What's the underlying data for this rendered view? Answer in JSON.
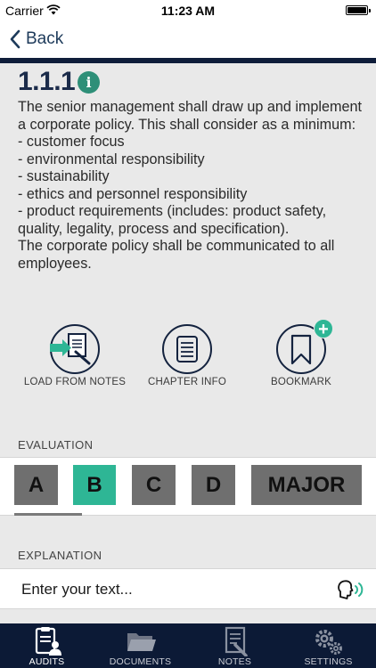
{
  "status_bar": {
    "carrier": "Carrier",
    "time": "11:23 AM"
  },
  "nav": {
    "back_label": "Back"
  },
  "requirement": {
    "number": "1.1.1",
    "text": "The senior management shall draw up and implement a corporate policy. This shall consider as a minimum:\n- customer focus\n- environmental responsibility\n- sustainability\n- ethics and personnel responsibility\n- product requirements (includes: product safety, quality, legality, process and specification).\n The corporate policy shall be communicated to all employees."
  },
  "actions": {
    "load_from_notes": "LOAD FROM NOTES",
    "chapter_info": "CHAPTER INFO",
    "bookmark": "BOOKMARK"
  },
  "evaluation": {
    "label": "EVALUATION",
    "options": [
      "A",
      "B",
      "C",
      "D",
      "MAJOR"
    ],
    "selected": "B",
    "colors": {
      "selected": "#2eb695",
      "default": "#6f6f6f"
    }
  },
  "explanation": {
    "label": "EXPLANATION",
    "placeholder": "Enter your text...",
    "value": ""
  },
  "tabs": [
    {
      "label": "AUDITS",
      "icon": "audit-clipboard-icon",
      "active": true
    },
    {
      "label": "DOCUMENTS",
      "icon": "folder-icon",
      "active": false
    },
    {
      "label": "NOTES",
      "icon": "note-pencil-icon",
      "active": false
    },
    {
      "label": "SETTINGS",
      "icon": "gears-icon",
      "active": false
    }
  ],
  "colors": {
    "accent": "#2eb695",
    "navy": "#0c1a36",
    "info": "#2e8f78"
  }
}
